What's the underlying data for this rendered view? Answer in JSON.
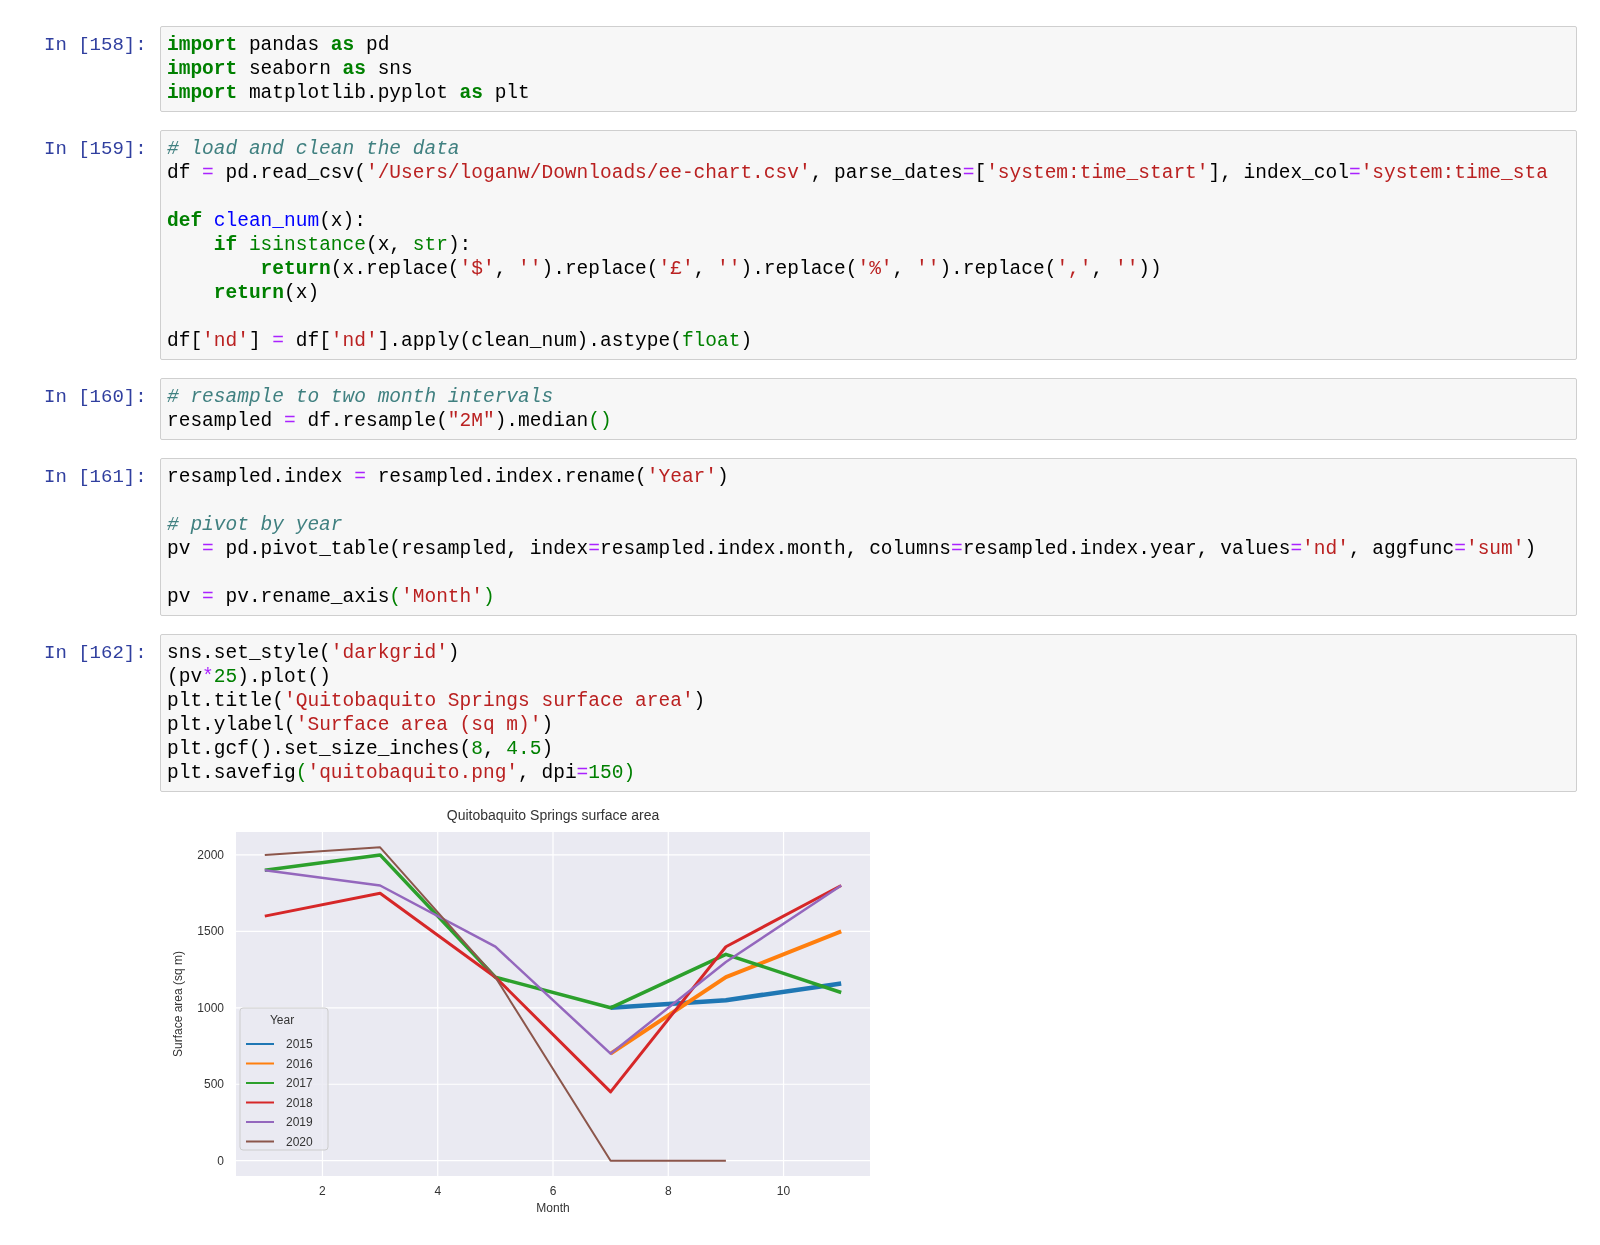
{
  "cells": [
    {
      "prompt": "In [158]:",
      "blocks": [
        [
          [
            {
              "kind": "kw",
              "text": "import"
            },
            {
              "kind": "plain",
              "text": " pandas "
            },
            {
              "kind": "kw",
              "text": "as"
            },
            {
              "kind": "plain",
              "text": " pd"
            }
          ],
          [
            {
              "kind": "kw",
              "text": "import"
            },
            {
              "kind": "plain",
              "text": " seaborn "
            },
            {
              "kind": "kw",
              "text": "as"
            },
            {
              "kind": "plain",
              "text": " sns"
            }
          ],
          [
            {
              "kind": "kw",
              "text": "import"
            },
            {
              "kind": "plain",
              "text": " matplotlib.pyplot "
            },
            {
              "kind": "kw",
              "text": "as"
            },
            {
              "kind": "plain",
              "text": " plt"
            }
          ]
        ]
      ]
    },
    {
      "prompt": "In [159]:",
      "blocks": [
        [
          [
            {
              "kind": "comment",
              "text": "# load and clean the data"
            }
          ],
          [
            {
              "kind": "plain",
              "text": "df "
            },
            {
              "kind": "op",
              "text": "="
            },
            {
              "kind": "plain",
              "text": " pd.read_csv("
            },
            {
              "kind": "str",
              "text": "'/Users/loganw/Downloads/ee-chart.csv'"
            },
            {
              "kind": "plain",
              "text": ", parse_dates"
            },
            {
              "kind": "op",
              "text": "="
            },
            {
              "kind": "plain",
              "text": "["
            },
            {
              "kind": "str",
              "text": "'system:time_start'"
            },
            {
              "kind": "plain",
              "text": "], index_col"
            },
            {
              "kind": "op",
              "text": "="
            },
            {
              "kind": "str",
              "text": "'system:time_sta"
            }
          ]
        ],
        [
          [
            {
              "kind": "kw",
              "text": "def "
            },
            {
              "kind": "func",
              "text": "clean_num"
            },
            {
              "kind": "plain",
              "text": "(x):"
            }
          ],
          [
            {
              "kind": "kw",
              "text": "    if "
            },
            {
              "kind": "builtin",
              "text": "isinstance"
            },
            {
              "kind": "plain",
              "text": "(x, "
            },
            {
              "kind": "builtin",
              "text": "str"
            },
            {
              "kind": "plain",
              "text": "):"
            }
          ],
          [
            {
              "kind": "kw",
              "text": "        return"
            },
            {
              "kind": "plain",
              "text": "(x.replace("
            },
            {
              "kind": "str",
              "text": "'$'"
            },
            {
              "kind": "plain",
              "text": ", "
            },
            {
              "kind": "str",
              "text": "''"
            },
            {
              "kind": "plain",
              "text": ").replace("
            },
            {
              "kind": "str",
              "text": "'£'"
            },
            {
              "kind": "plain",
              "text": ", "
            },
            {
              "kind": "str",
              "text": "''"
            },
            {
              "kind": "plain",
              "text": ").replace("
            },
            {
              "kind": "str",
              "text": "'%'"
            },
            {
              "kind": "plain",
              "text": ", "
            },
            {
              "kind": "str",
              "text": "''"
            },
            {
              "kind": "plain",
              "text": ").replace("
            },
            {
              "kind": "str",
              "text": "','"
            },
            {
              "kind": "plain",
              "text": ", "
            },
            {
              "kind": "str",
              "text": "''"
            },
            {
              "kind": "plain",
              "text": "))"
            }
          ],
          [
            {
              "kind": "kw",
              "text": "    return"
            },
            {
              "kind": "plain",
              "text": "(x)"
            }
          ]
        ],
        [
          [
            {
              "kind": "plain",
              "text": "df["
            },
            {
              "kind": "str",
              "text": "'nd'"
            },
            {
              "kind": "plain",
              "text": "] "
            },
            {
              "kind": "op",
              "text": "="
            },
            {
              "kind": "plain",
              "text": " df["
            },
            {
              "kind": "str",
              "text": "'nd'"
            },
            {
              "kind": "plain",
              "text": "].apply(clean_num).astype("
            },
            {
              "kind": "builtin",
              "text": "float"
            },
            {
              "kind": "plain",
              "text": ")"
            }
          ]
        ]
      ]
    },
    {
      "prompt": "In [160]:",
      "blocks": [
        [
          [
            {
              "kind": "comment",
              "text": "# resample to two month intervals"
            }
          ],
          [
            {
              "kind": "plain",
              "text": "resampled "
            },
            {
              "kind": "op",
              "text": "="
            },
            {
              "kind": "plain",
              "text": " df.resample("
            },
            {
              "kind": "str",
              "text": "\"2M\""
            },
            {
              "kind": "plain",
              "text": ").median"
            },
            {
              "kind": "builtin",
              "text": "()"
            }
          ]
        ]
      ]
    },
    {
      "prompt": "In [161]:",
      "blocks": [
        [
          [
            {
              "kind": "plain",
              "text": "resampled.index "
            },
            {
              "kind": "op",
              "text": "="
            },
            {
              "kind": "plain",
              "text": " resampled.index.rename("
            },
            {
              "kind": "str",
              "text": "'Year'"
            },
            {
              "kind": "plain",
              "text": ")"
            }
          ]
        ],
        [
          [
            {
              "kind": "comment",
              "text": "# pivot by year"
            }
          ],
          [
            {
              "kind": "plain",
              "text": "pv "
            },
            {
              "kind": "op",
              "text": "="
            },
            {
              "kind": "plain",
              "text": " pd.pivot_table(resampled, index"
            },
            {
              "kind": "op",
              "text": "="
            },
            {
              "kind": "plain",
              "text": "resampled.index.month, columns"
            },
            {
              "kind": "op",
              "text": "="
            },
            {
              "kind": "plain",
              "text": "resampled.index.year, values"
            },
            {
              "kind": "op",
              "text": "="
            },
            {
              "kind": "str",
              "text": "'nd'"
            },
            {
              "kind": "plain",
              "text": ", aggfunc"
            },
            {
              "kind": "op",
              "text": "="
            },
            {
              "kind": "str",
              "text": "'sum'"
            },
            {
              "kind": "plain",
              "text": ")"
            }
          ]
        ],
        [
          [
            {
              "kind": "plain",
              "text": "pv "
            },
            {
              "kind": "op",
              "text": "="
            },
            {
              "kind": "plain",
              "text": " pv.rename_axis"
            },
            {
              "kind": "builtin",
              "text": "("
            },
            {
              "kind": "str",
              "text": "'Month'"
            },
            {
              "kind": "builtin",
              "text": ")"
            }
          ]
        ]
      ]
    },
    {
      "prompt": "In [162]:",
      "blocks": [
        [
          [
            {
              "kind": "plain",
              "text": "sns.set_style("
            },
            {
              "kind": "str",
              "text": "'darkgrid'"
            },
            {
              "kind": "plain",
              "text": ")"
            }
          ],
          [
            {
              "kind": "plain",
              "text": "(pv"
            },
            {
              "kind": "op",
              "text": "*"
            },
            {
              "kind": "num",
              "text": "25"
            },
            {
              "kind": "plain",
              "text": ").plot()"
            }
          ],
          [
            {
              "kind": "plain",
              "text": "plt.title("
            },
            {
              "kind": "str",
              "text": "'Quitobaquito Springs surface area'"
            },
            {
              "kind": "plain",
              "text": ")"
            }
          ],
          [
            {
              "kind": "plain",
              "text": "plt.ylabel("
            },
            {
              "kind": "str",
              "text": "'Surface area (sq m)'"
            },
            {
              "kind": "plain",
              "text": ")"
            }
          ],
          [
            {
              "kind": "plain",
              "text": "plt.gcf().set_size_inches("
            },
            {
              "kind": "num",
              "text": "8"
            },
            {
              "kind": "plain",
              "text": ", "
            },
            {
              "kind": "num",
              "text": "4.5"
            },
            {
              "kind": "plain",
              "text": ")"
            }
          ],
          [
            {
              "kind": "plain",
              "text": "plt.savefig"
            },
            {
              "kind": "builtin",
              "text": "("
            },
            {
              "kind": "str",
              "text": "'quitobaquito.png'"
            },
            {
              "kind": "plain",
              "text": ", dpi"
            },
            {
              "kind": "op",
              "text": "="
            },
            {
              "kind": "num",
              "text": "150"
            },
            {
              "kind": "builtin",
              "text": ")"
            }
          ]
        ]
      ],
      "output": {
        "chart_data": {
          "type": "line",
          "grid": true,
          "legend": {
            "title": "Year"
          },
          "title": "Quitobaquito Springs surface area",
          "xlabel": "Month",
          "ylabel": "Surface area (sq m)",
          "x": [
            1,
            3,
            5,
            7,
            9,
            11
          ],
          "series": [
            {
              "name": "2015",
              "color": "#1f77b4",
              "values": [
                null,
                null,
                null,
                1000,
                1050,
                1160
              ]
            },
            {
              "name": "2016",
              "color": "#ff7f0e",
              "values": [
                null,
                null,
                null,
                700,
                1200,
                1500
              ]
            },
            {
              "name": "2017",
              "color": "#2ca02c",
              "values": [
                1900,
                2000,
                1200,
                1000,
                1350,
                1100
              ]
            },
            {
              "name": "2018",
              "color": "#d62728",
              "values": [
                1600,
                1750,
                1200,
                450,
                1400,
                1800
              ]
            },
            {
              "name": "2019",
              "color": "#9467bd",
              "values": [
                1900,
                1800,
                1400,
                700,
                1300,
                1800
              ]
            },
            {
              "name": "2020",
              "color": "#8c564b",
              "values": [
                2000,
                2050,
                1200,
                0,
                0,
                null
              ]
            }
          ],
          "xlim": [
            0.5,
            11.5
          ],
          "ylim": [
            -100,
            2150
          ],
          "xticks": [
            2,
            4,
            6,
            8,
            10
          ],
          "yticks": [
            0,
            500,
            1000,
            1500,
            2000
          ]
        }
      }
    }
  ]
}
